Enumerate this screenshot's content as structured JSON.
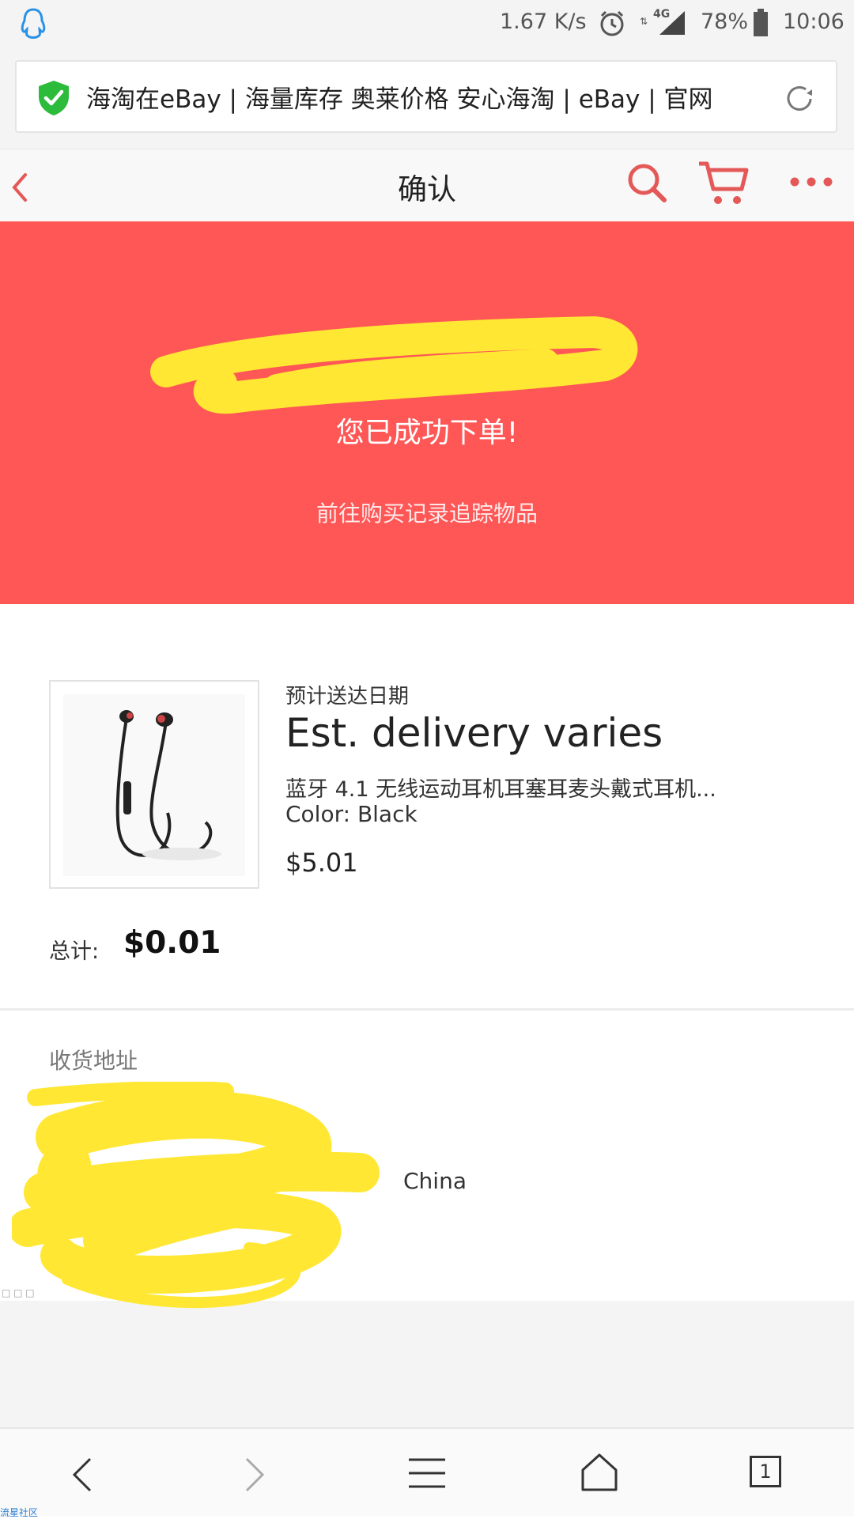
{
  "colors": {
    "accent_red": "#ff5656",
    "icon_red": "#e45858",
    "shield_green": "#2dbb3c",
    "scribble_yellow": "#ffe733"
  },
  "status_bar": {
    "speed": "1.67 K/s",
    "network": "4G",
    "battery": "78%",
    "time": "10:06",
    "icons": [
      "qq-penguin-icon",
      "alarm-icon",
      "signal-icon",
      "battery-icon"
    ]
  },
  "address_bar": {
    "title": "海淘在eBay | 海量库存 奥莱价格 安心海淘 | eBay | 官网",
    "icons": [
      "shield-check-icon",
      "reload-icon"
    ]
  },
  "nav": {
    "title": "确认",
    "icons": [
      "back-chevron-icon",
      "search-icon",
      "cart-icon",
      "more-dots-icon"
    ]
  },
  "banner": {
    "subtitle": "您已成功下单!",
    "link": "前往购买记录追踪物品"
  },
  "order": {
    "eta_label": "预计送达日期",
    "eta_value": "Est. delivery varies",
    "item_title": "蓝牙 4.1 无线运动耳机耳塞耳麦头戴式耳机...",
    "item_color": "Color: Black",
    "item_price": "$5.01",
    "total_label": "总计:",
    "total_value": "$0.01"
  },
  "shipping": {
    "label": "收货地址",
    "country_fragment": "China"
  },
  "footer_tiny": "□ □ □",
  "watermark": "流星社区",
  "bottom_bar": {
    "tab_count": "1",
    "icons": [
      "back-arrow-icon",
      "forward-arrow-icon",
      "menu-icon",
      "home-icon",
      "tabs-icon"
    ]
  }
}
